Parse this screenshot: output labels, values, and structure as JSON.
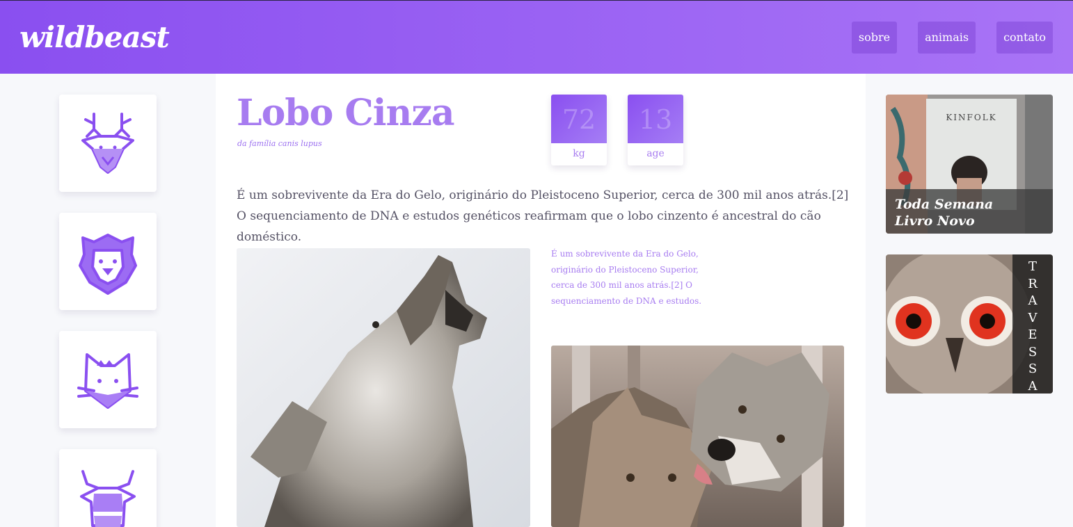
{
  "header": {
    "logo": "wildbeast",
    "nav": [
      "sobre",
      "animais",
      "contato"
    ]
  },
  "sidebar": {
    "icons": [
      "deer-icon",
      "lion-icon",
      "cat-icon",
      "bull-icon"
    ]
  },
  "animal": {
    "name": "Lobo Cinza",
    "family": "da família canis lupus",
    "stats": [
      {
        "value": "72",
        "label": "kg"
      },
      {
        "value": "13",
        "label": "age"
      }
    ],
    "description": "É um sobrevivente da Era do Gelo, originário do Pleistoceno Superior, cerca de 300 mil anos atrás.[2] O sequenciamento de DNA e estudos genéticos reafirmam que o lobo cinzento é ancestral do cão doméstico.",
    "caption": "É um sobrevivente da Era do Gelo, originário do Pleistoceno Superior, cerca de 300 mil anos atrás.[2] O sequenciamento de DNA e estudos."
  },
  "ads": {
    "kinfolk": {
      "cover_title": "KINFOLK",
      "text_line1": "Toda Semana",
      "text_line2": "Livro Novo"
    },
    "travessa": {
      "letters": [
        "T",
        "R",
        "A",
        "V",
        "E",
        "S",
        "S",
        "A"
      ]
    }
  },
  "colors": {
    "accent": "#a77cf0",
    "header_start": "#8a4ff0",
    "header_end": "#a974f6"
  }
}
